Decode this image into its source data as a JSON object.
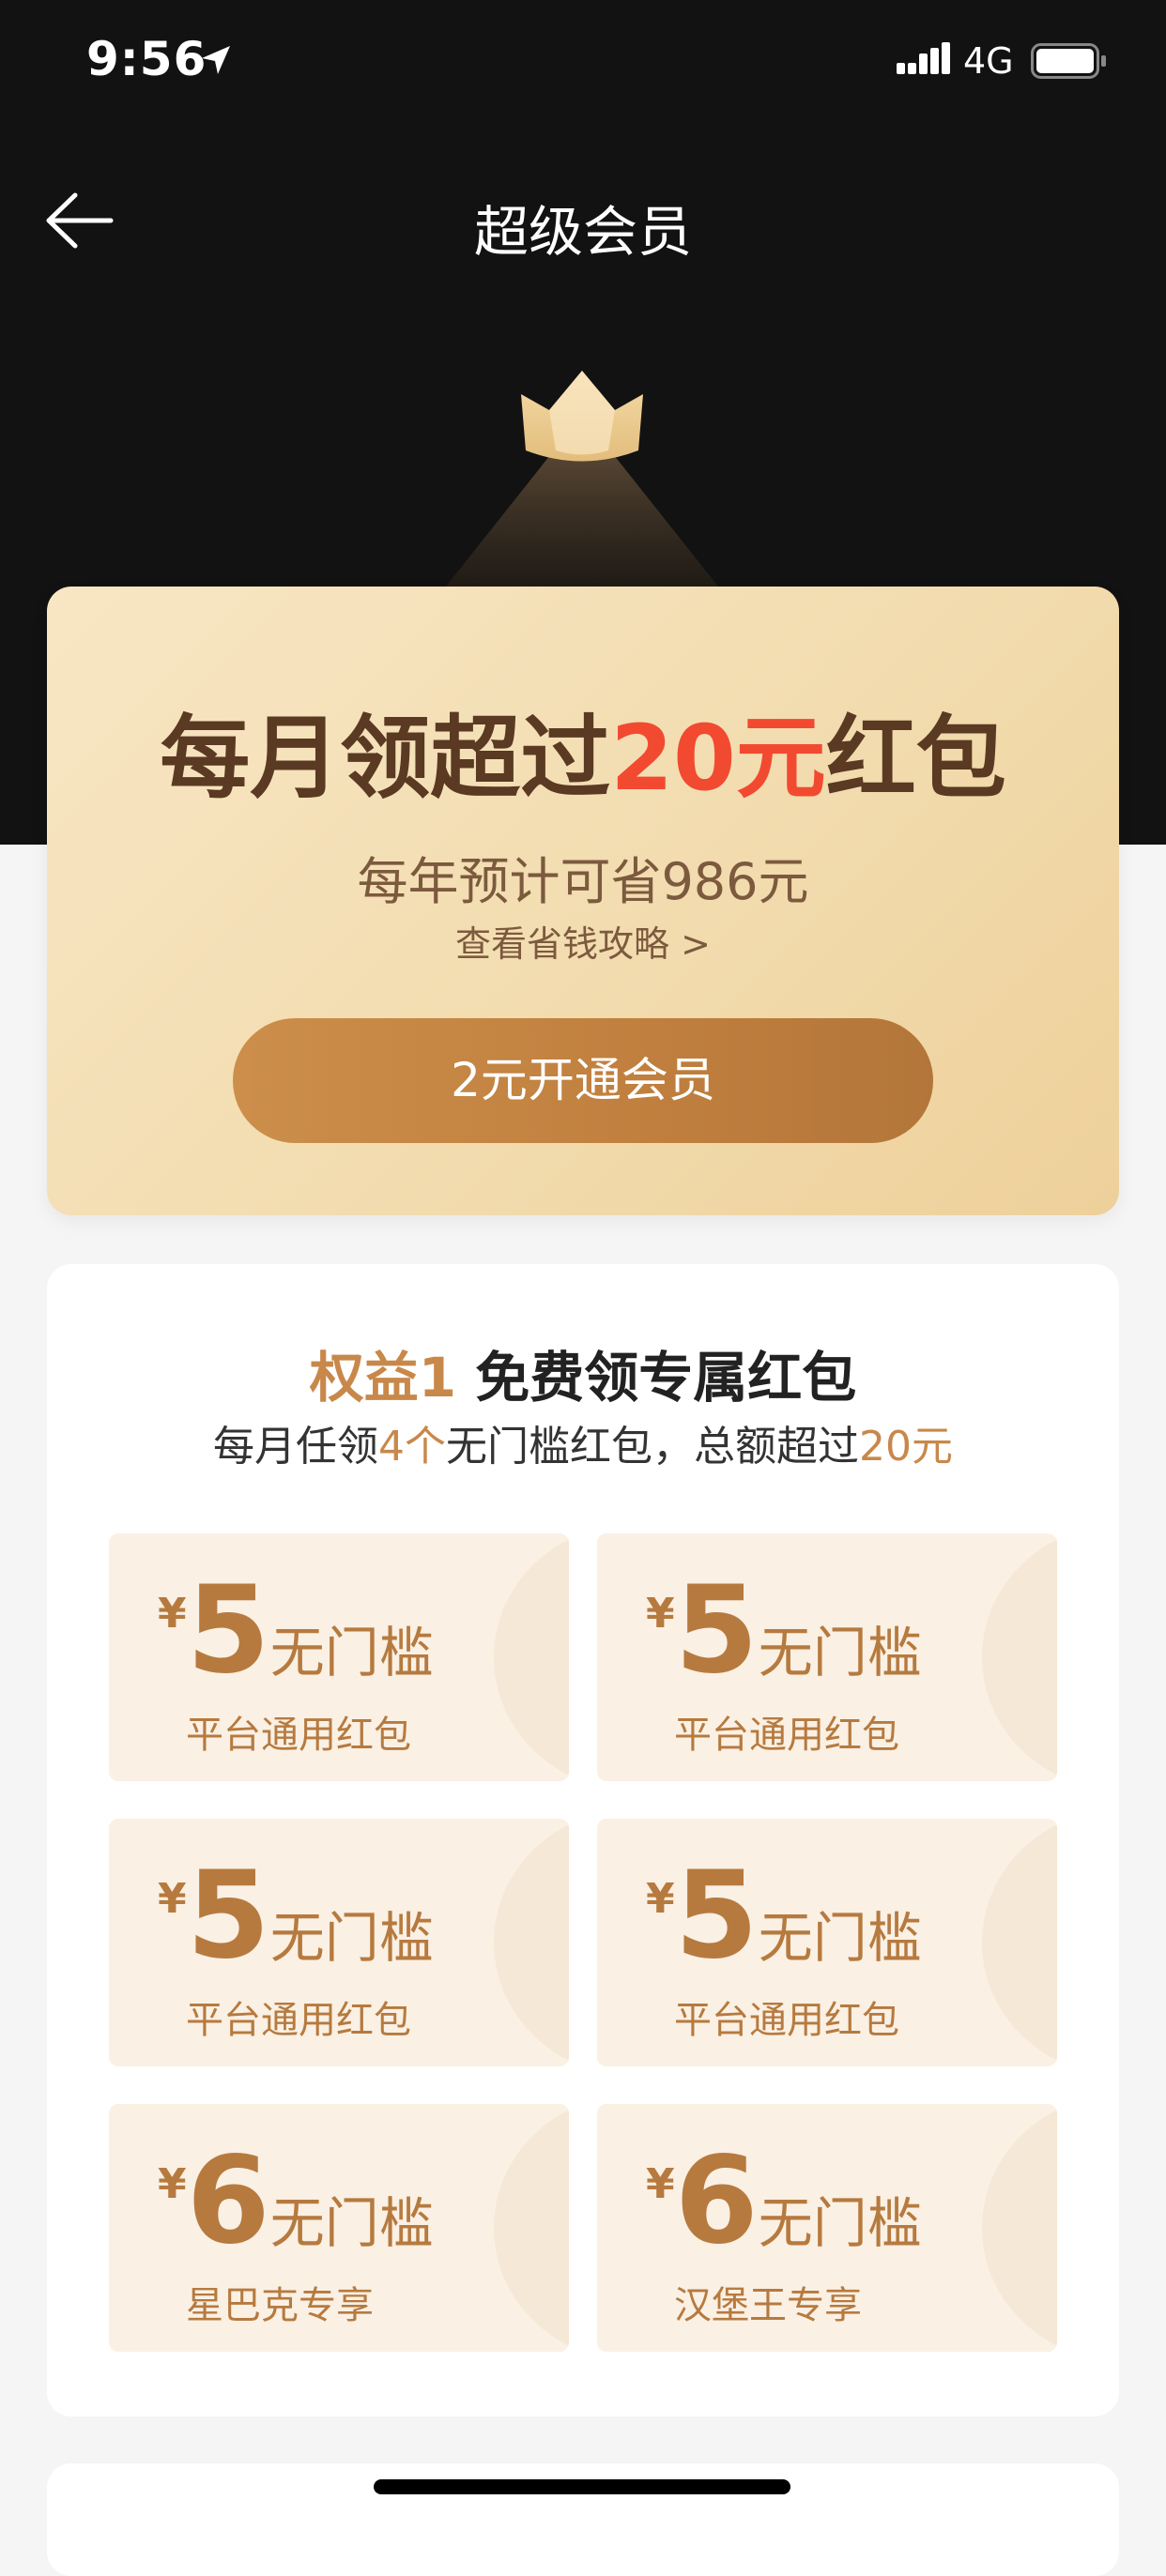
{
  "status_bar": {
    "time": "9:56",
    "network": "4G"
  },
  "nav": {
    "title": "超级会员"
  },
  "hero": {
    "headline_prefix": "每月领超过",
    "headline_highlight": "20元",
    "headline_suffix": "红包",
    "subtitle": "每年预计可省986元",
    "guide_link": "查看省钱攻略 >",
    "join_button": "2元开通会员"
  },
  "benefit": {
    "tag": "权益1",
    "title": " 免费领专属红包",
    "desc_prefix": "每月任领",
    "desc_count": "4个",
    "desc_middle": "无门槛红包，总额超过",
    "desc_amount": "20元",
    "coupons": [
      {
        "currency": "¥",
        "amount": "5",
        "label": "无门槛",
        "sub": "平台通用红包"
      },
      {
        "currency": "¥",
        "amount": "5",
        "label": "无门槛",
        "sub": "平台通用红包"
      },
      {
        "currency": "¥",
        "amount": "5",
        "label": "无门槛",
        "sub": "平台通用红包"
      },
      {
        "currency": "¥",
        "amount": "5",
        "label": "无门槛",
        "sub": "平台通用红包"
      },
      {
        "currency": "¥",
        "amount": "6",
        "label": "无门槛",
        "sub": "星巴克专享"
      },
      {
        "currency": "¥",
        "amount": "6",
        "label": "无门槛",
        "sub": "汉堡王专享"
      }
    ]
  },
  "colors": {
    "accent": "#c8884a",
    "highlight": "#f24a30",
    "dark": "#121212"
  }
}
